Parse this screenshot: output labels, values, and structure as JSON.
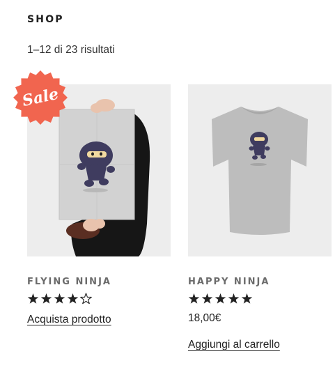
{
  "header": {
    "title": "SHOP"
  },
  "results": {
    "count_text": "1–12 di 23 risultati"
  },
  "products": [
    {
      "name": "FLYING NINJA",
      "badge": "Sale",
      "rating": 4,
      "rating_max": 5,
      "cta_label": "Acquista prodotto",
      "image": "poster-ninja"
    },
    {
      "name": "HAPPY NINJA",
      "rating": 5,
      "rating_max": 5,
      "price": "18,00€",
      "cta_label": "Aggiungi al carrello",
      "image": "tshirt-ninja"
    }
  ],
  "colors": {
    "badge": "#f1654f",
    "star": "#222222",
    "title_gray": "#6b6b6b",
    "thumb_bg": "#ededed"
  }
}
